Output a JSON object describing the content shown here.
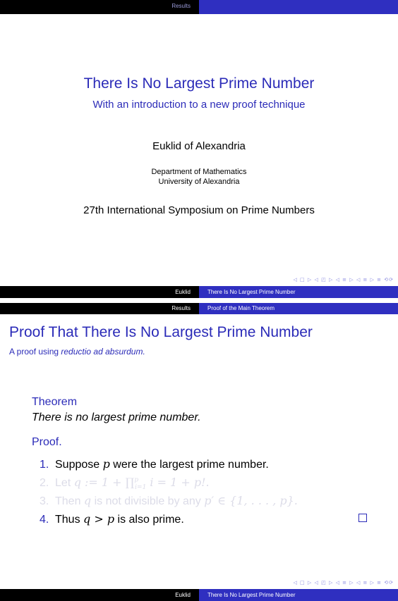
{
  "slide1": {
    "headline_left": "Results",
    "headline_right": "",
    "title": "There Is No Largest Prime Number",
    "subtitle": "With an introduction to a new proof technique",
    "author": "Euklid of Alexandria",
    "institute_line1": "Department of Mathematics",
    "institute_line2": "University of Alexandria",
    "date": "27th International Symposium on Prime Numbers",
    "nav_symbols": "◁ □ ▷ ◁ ◰ ▷ ◁ ≡ ▷ ◁ ≡ ▷ ≡ ⟲⟳",
    "footer_left": "Euklid",
    "footer_right": "There Is No Largest Prime Number"
  },
  "slide2": {
    "headline_left": "Results",
    "headline_right": "Proof of the Main Theorem",
    "frame_title": "Proof That There Is No Largest Prime Number",
    "frame_subtitle_prefix": "A proof using ",
    "frame_subtitle_emph": "reductio ad absurdum.",
    "theorem_title": "Theorem",
    "theorem_body": "There is no largest prime number.",
    "proof_title": "Proof.",
    "steps": [
      {
        "num": "1.",
        "text_a": "Suppose ",
        "var": "p",
        "text_b": " were the largest prime number."
      },
      {
        "num": "2.",
        "text_a": "Let ",
        "formula": "q := 1 + ∏",
        "sup": "p",
        "sub": "i=1",
        "formula_b": " i = 1 + p!."
      },
      {
        "num": "3.",
        "text_a": "Then ",
        "var": "q",
        "text_b": " is not divisible by any ",
        "formula": "p′ ∈ {1, . . . , p}."
      },
      {
        "num": "4.",
        "text_a": "Thus ",
        "formula": "q > p",
        "text_b": " is also prime."
      }
    ],
    "nav_symbols": "◁ □ ▷ ◁ ◰ ▷ ◁ ≡ ▷ ◁ ≡ ▷ ≡ ⟲⟳",
    "footer_left": "Euklid",
    "footer_right": "There Is No Largest Prime Number"
  }
}
